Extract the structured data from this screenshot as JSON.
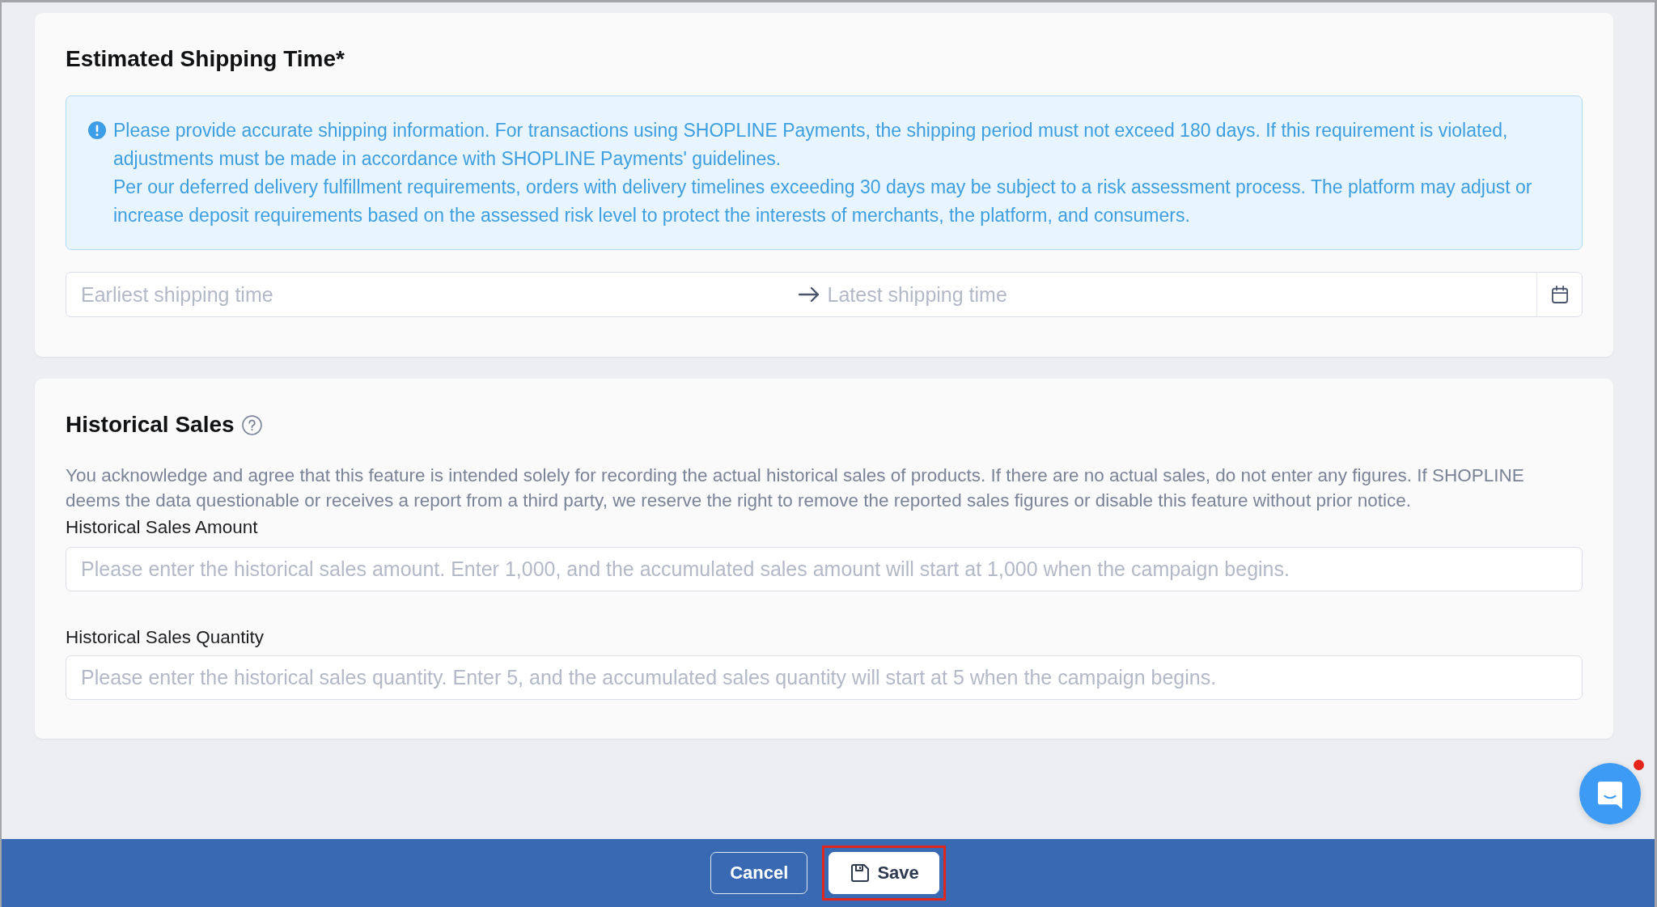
{
  "sections": [
    {
      "title": "Estimated Shipping Time*",
      "help": false,
      "notice": {
        "paragraphs": [
          "Please provide accurate shipping information. For transactions using SHOPLINE Payments, the shipping period must not exceed 180 days. If this requirement is violated, adjustments must be made in accordance with SHOPLINE Payments' guidelines.",
          "Per our deferred delivery fulfillment requirements, orders with delivery timelines exceeding 30 days may be subject to a risk assessment process. The platform may adjust or increase deposit requirements based on the assessed risk level to protect the interests of merchants, the platform, and consumers."
        ]
      },
      "date_range": {
        "start_placeholder": "Earliest shipping time",
        "end_placeholder": "Latest shipping time"
      }
    },
    {
      "title": "Historical Sales",
      "help": true,
      "description": "You acknowledge and agree that this feature is intended solely for recording the actual historical sales of products. If there are no actual sales, do not enter any figures. If SHOPLINE deems the data questionable or receives a report from a third party, we reserve the right to remove the reported sales figures or disable this feature without prior notice.",
      "fields": [
        {
          "label": "Historical Sales Amount",
          "placeholder": "Please enter the historical sales amount. Enter 1,000, and the accumulated sales amount will start at 1,000 when the campaign begins."
        },
        {
          "label": "Historical Sales Quantity",
          "placeholder": "Please enter the historical sales quantity. Enter 5, and the accumulated sales quantity will start at 5 when the campaign begins."
        }
      ]
    }
  ],
  "footer": {
    "buttons": [
      {
        "label": "Cancel",
        "kind": "secondary",
        "highlighted": false
      },
      {
        "label": "Save",
        "kind": "primary",
        "highlighted": true
      }
    ]
  },
  "chat": {
    "unread": true
  }
}
